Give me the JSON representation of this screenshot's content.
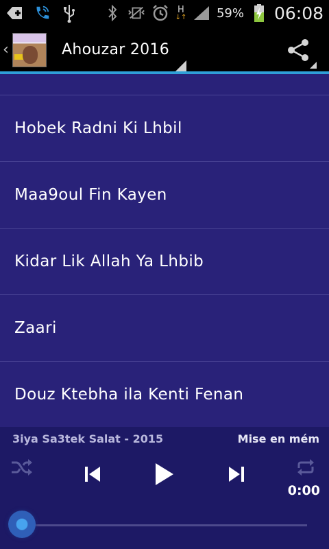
{
  "status_bar": {
    "battery_percent": "59%",
    "time": "06:08",
    "network_label": "H",
    "icons": [
      "add-notification-icon",
      "phone-call-icon",
      "usb-icon",
      "bluetooth-icon",
      "vibrate-icon",
      "alarm-icon",
      "signal-icon",
      "battery-charging-icon"
    ]
  },
  "action_bar": {
    "title": "Ahouzar 2016",
    "back_glyph": "‹",
    "icons": [
      "back-chevron-icon",
      "app-logo",
      "share-icon"
    ]
  },
  "list": {
    "items": [
      {
        "label": "Hobek Radni Ki Lhbil"
      },
      {
        "label": "Maa9oul Fin Kayen"
      },
      {
        "label": "Kidar Lik Allah Ya Lhbib"
      },
      {
        "label": "Zaari"
      },
      {
        "label": "Douz Ktebha ila Kenti Fenan"
      }
    ]
  },
  "player": {
    "now_playing": "3iya Sa3tek Salat - 2015",
    "status": "Mise en mém",
    "time": "0:00",
    "progress": 0,
    "icons": [
      "shuffle-icon",
      "previous-icon",
      "play-icon",
      "next-icon",
      "repeat-icon"
    ]
  },
  "colors": {
    "list_background": "#292279",
    "player_background": "#1d1965",
    "accent": "#2f9fd8"
  }
}
